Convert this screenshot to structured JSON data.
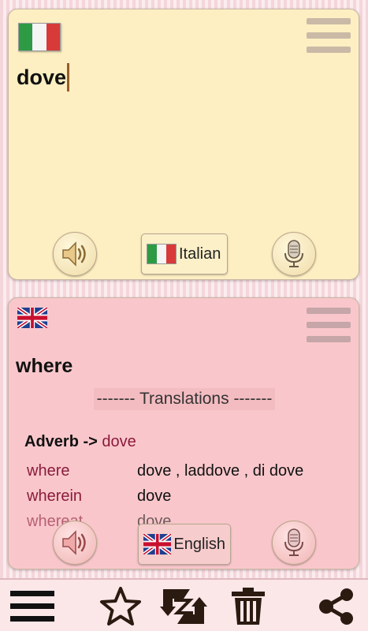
{
  "source_panel": {
    "language": "Italian",
    "flag": "italy-flag",
    "input_text": "dove"
  },
  "target_panel": {
    "language": "English",
    "flag": "uk-flag",
    "result_word": "where",
    "translations_header": "------- Translations -------",
    "part_of_speech": "Adverb",
    "pos_arrow": " -> ",
    "pos_word": "dove",
    "rows": [
      {
        "term": "where",
        "meaning": "dove , laddove , di dove"
      },
      {
        "term": "wherein",
        "meaning": "dove"
      },
      {
        "term": "whereat",
        "meaning": "dove"
      }
    ]
  },
  "icons": {
    "speaker": "speaker-icon",
    "mic": "microphone-icon",
    "menu": "hamburger-icon",
    "favorite": "star-icon",
    "swap": "swap-icon",
    "delete": "trash-icon",
    "share": "share-icon"
  },
  "colors": {
    "source_bg": "#fdefc2",
    "target_bg": "#f9c7cb",
    "accent": "#8a1b3c"
  }
}
